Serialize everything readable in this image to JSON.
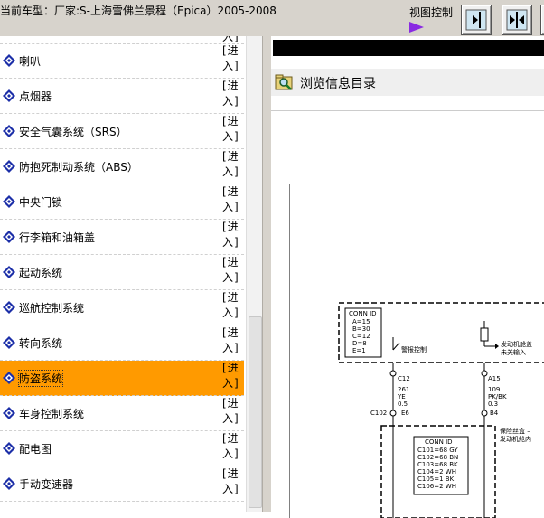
{
  "header": {
    "title": "当前车型：厂家:S-上海雪佛兰景程（Epica）2005-2008",
    "view_control_label": "视图控制",
    "view_buttons": [
      "view-right-icon",
      "view-split-icon",
      "view-left-icon"
    ]
  },
  "nav": {
    "partial_enter": "[进入]",
    "items": [
      {
        "label": "喇叭",
        "enter": "[进入]"
      },
      {
        "label": "点烟器",
        "enter": "[进入]"
      },
      {
        "label": "安全气囊系统（SRS）",
        "enter": "[进入]"
      },
      {
        "label": "防抱死制动系统（ABS）",
        "enter": "[进入]"
      },
      {
        "label": "中央门锁",
        "enter": "[进入]"
      },
      {
        "label": "行李箱和油箱盖",
        "enter": "[进入]"
      },
      {
        "label": "起动系统",
        "enter": "[进入]"
      },
      {
        "label": "巡航控制系统",
        "enter": "[进入]"
      },
      {
        "label": "转向系统",
        "enter": "[进入]"
      },
      {
        "label": "防盗系统",
        "enter": "[进入]",
        "selected": true
      },
      {
        "label": "车身控制系统",
        "enter": "[进入]"
      },
      {
        "label": "配电图",
        "enter": "[进入]"
      },
      {
        "label": "手动变速器",
        "enter": "[进入]"
      }
    ],
    "selected_color": "#ff9a00",
    "icon": "diamond-doc-icon"
  },
  "content": {
    "browse_title": "浏览信息目录",
    "browse_icon": "folder-search-icon"
  },
  "diagram": {
    "conn1_title": "CONN ID",
    "conn1_lines": [
      "A=15",
      "B=30",
      "C=12",
      "D=8",
      "E=1"
    ],
    "alarm_control": "警报控制",
    "engine_hood_line1": "发动机舱盖",
    "engine_hood_line2": "未关输入",
    "c12": "C12",
    "c12_wire": [
      "261",
      "YE",
      "0.5"
    ],
    "a15": "A15",
    "a15_wire": [
      "109",
      "PK/BK",
      "0.3"
    ],
    "c102": "C102",
    "e6": "E6",
    "b4": "B4",
    "fuse_box_line1": "保险丝盒 –",
    "fuse_box_line2": "发动机舱内",
    "conn2_title": "CONN ID",
    "conn2_lines": [
      "C101=68 GY",
      "C102=68 BN",
      "C103=68 BK",
      "C104=2 WH",
      "C105=1 BK",
      "C106=2 WH"
    ]
  }
}
